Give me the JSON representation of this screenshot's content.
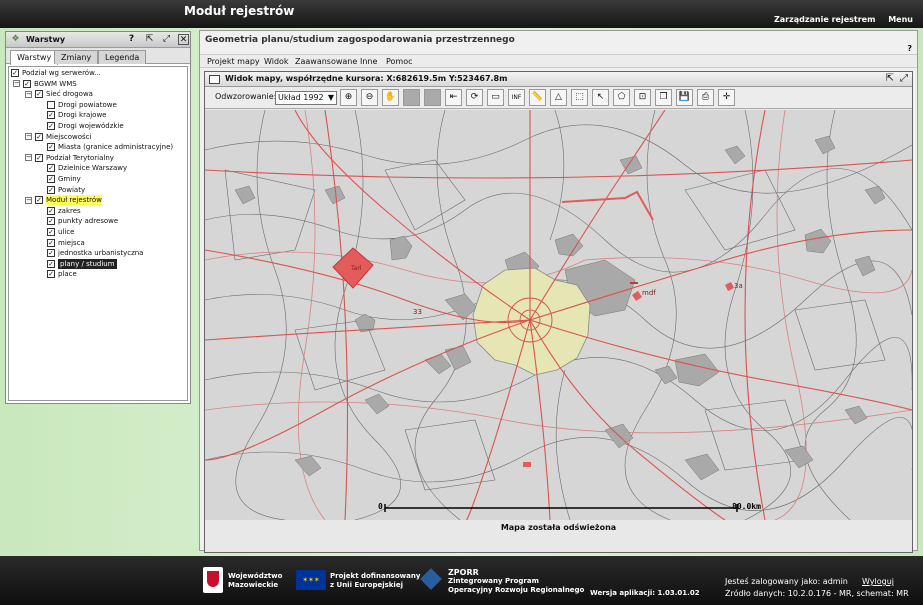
{
  "app": {
    "title": "Moduł rejestrów",
    "links": [
      "Zarządzanie rejestrem",
      "Menu"
    ]
  },
  "layers": {
    "title": "Warstwy",
    "tabs": [
      "Warstwy",
      "Zmiany",
      "Legenda"
    ],
    "tree": [
      {
        "label": "Podział wg serwerów...",
        "level": 0,
        "checked": true
      },
      {
        "label": "BGWM WMS",
        "level": 1,
        "checked": true,
        "expander": "−"
      },
      {
        "label": "Sieć drogowa",
        "level": 2,
        "checked": true,
        "expander": "−"
      },
      {
        "label": "Drogi powiatowe",
        "level": 3,
        "checked": false
      },
      {
        "label": "Drogi krajowe",
        "level": 3,
        "checked": true
      },
      {
        "label": "Drogi wojewódzkie",
        "level": 3,
        "checked": true
      },
      {
        "label": "Miejscowości",
        "level": 2,
        "checked": true,
        "expander": "−"
      },
      {
        "label": "Miasta (granice administracyjne)",
        "level": 3,
        "checked": true
      },
      {
        "label": "Podział Terytorialny",
        "level": 2,
        "checked": true,
        "expander": "−"
      },
      {
        "label": "Dzielnice Warszawy",
        "level": 3,
        "checked": true
      },
      {
        "label": "Gminy",
        "level": 3,
        "checked": true
      },
      {
        "label": "Powiaty",
        "level": 3,
        "checked": true
      },
      {
        "label": "Moduł rejestrów",
        "level": 2,
        "checked": true,
        "expander": "−",
        "highlight": true
      },
      {
        "label": "zakres",
        "level": 3,
        "checked": true
      },
      {
        "label": "punkty adresowe",
        "level": 3,
        "checked": true
      },
      {
        "label": "ulice",
        "level": 3,
        "checked": true
      },
      {
        "label": "miejsca",
        "level": 3,
        "checked": true
      },
      {
        "label": "jednostka urbanistyczna",
        "level": 3,
        "checked": true
      },
      {
        "label": "plany / studium",
        "level": 3,
        "checked": true,
        "selected": true
      },
      {
        "label": "place",
        "level": 3,
        "checked": true
      }
    ]
  },
  "main": {
    "title": "Geometria planu/studium zagospodarowania przestrzennego",
    "help": "?",
    "menu": [
      "Projekt mapy",
      "Widok",
      "Zaawansowane",
      "Inne",
      "Pomoc"
    ],
    "map_window_title": "Widok mapy, współrzędne kursora: X:682619.5m Y:523467.8m",
    "projection_label": "Odwzorowanie:",
    "projection_value": "Układ 1992",
    "scale_start": "0",
    "scale_end": "80.0km",
    "status": "Mapa została odświeżona",
    "map_labels": {
      "road_33": "33",
      "plan_label": "Tarl",
      "mdf": "mdf",
      "l3": "3a"
    }
  },
  "footer": {
    "logo1": [
      "Województwo",
      "Mazowieckie"
    ],
    "logo2": [
      "Projekt dofinansowany",
      "z Unii Europejskiej"
    ],
    "logo3": [
      "ZPORR",
      "Zintegrowany Program",
      "Operacyjny Rozwoju Regionalnego"
    ],
    "version": "Wersja aplikacji: 1.03.01.02",
    "logged_label": "Jesteś zalogowany jako: admin",
    "logout": "Wyloguj",
    "source": "Źródło danych: 10.2.0.176 - MR, schemat: MR"
  },
  "colors": {
    "city_fill": "#e6e6b4",
    "plan_red": "#e35b5b",
    "road_red": "#d9534f",
    "map_bg": "#d8d8d8"
  }
}
